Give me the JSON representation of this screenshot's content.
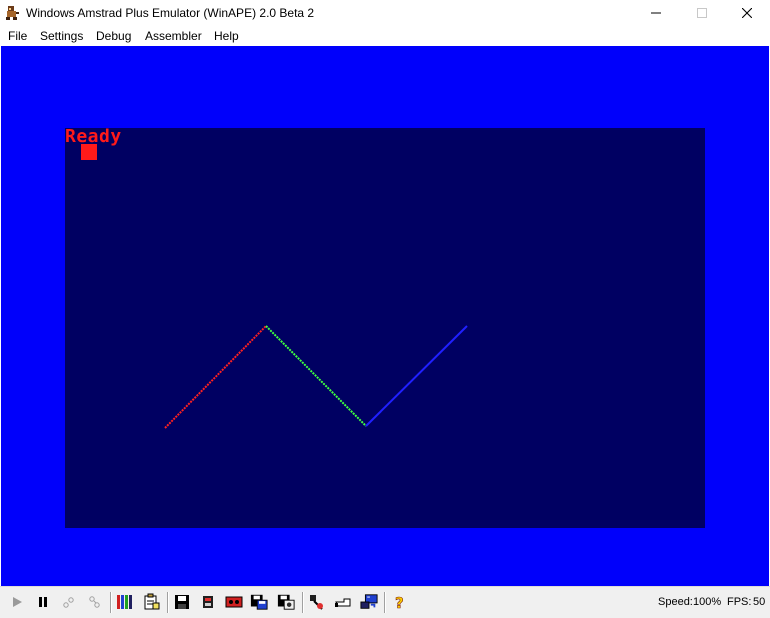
{
  "window": {
    "title": "Windows Amstrad Plus Emulator (WinAPE) 2.0 Beta 2"
  },
  "menu": [
    "File",
    "Settings",
    "Debug",
    "Assembler",
    "Help"
  ],
  "screen": {
    "prompt": "Ready",
    "colors": {
      "border": "#0000fb",
      "paper": "#000062",
      "text": "#ff1a1a",
      "line1": "#ff2020",
      "line2": "#40ff40",
      "line3": "#2020ff"
    }
  },
  "toolbar": {
    "icons": [
      "play-icon",
      "pause-icon",
      "step-icon",
      "step-over-icon",
      "tape-icon",
      "clipboard-icon",
      "disk-icon",
      "rom-icon",
      "cassette-icon",
      "save-disk-icon",
      "snapshot-icon",
      "joystick-icon",
      "hand-icon",
      "monitor-icon",
      "help-icon"
    ]
  },
  "status": {
    "speed_label": "Speed:",
    "speed_value": "100%",
    "fps_label": "FPS:",
    "fps_value": "50"
  }
}
